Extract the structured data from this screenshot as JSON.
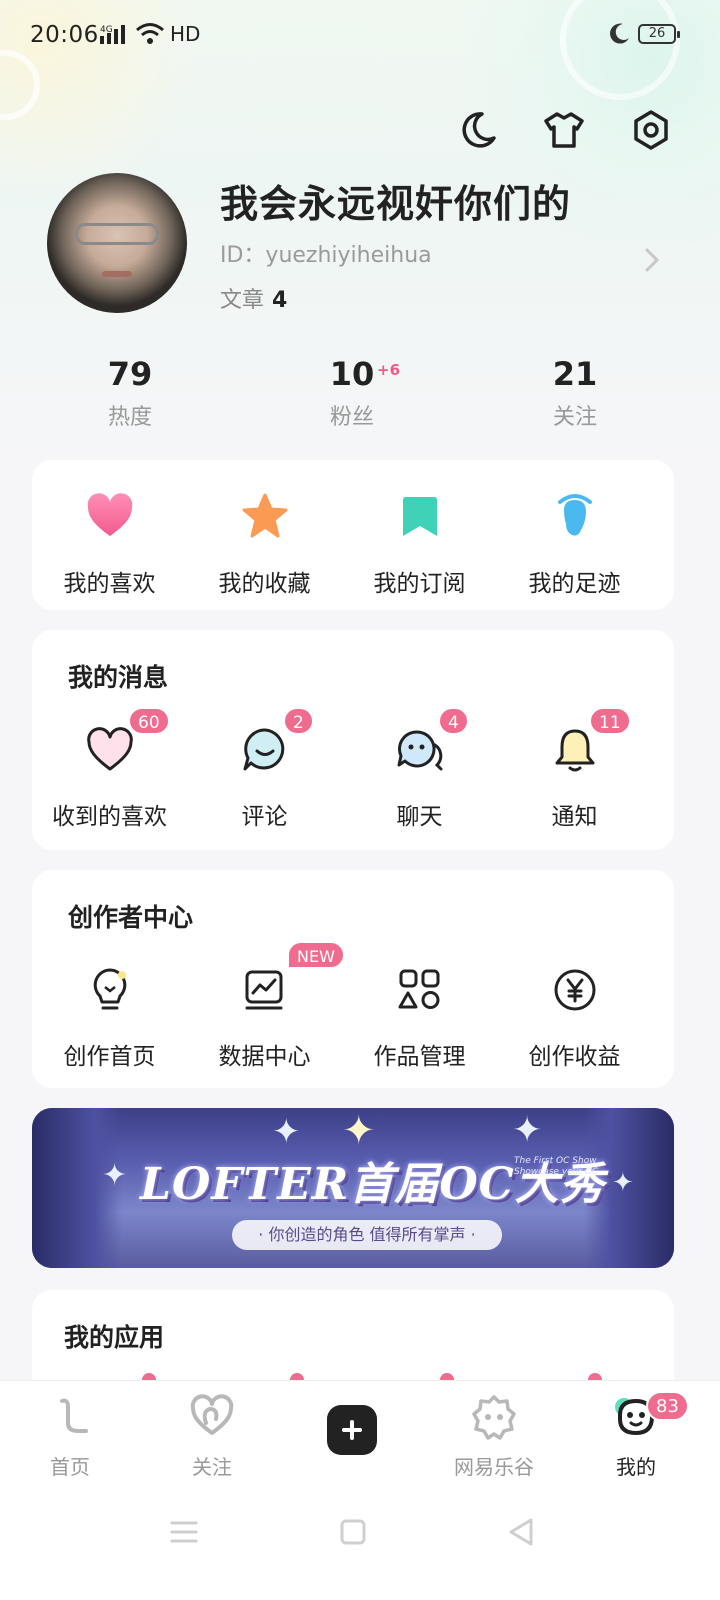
{
  "status_bar": {
    "time": "20:06",
    "signal": "4G",
    "network": "HD",
    "battery": "26"
  },
  "profile": {
    "username": "我会永远视奸你们的",
    "id_label": "ID：yuezhiyiheihua",
    "articles_label": "文章",
    "articles_count": "4"
  },
  "stats": [
    {
      "value": "79",
      "label": "热度"
    },
    {
      "value": "10",
      "label": "粉丝",
      "delta": "+6"
    },
    {
      "value": "21",
      "label": "关注"
    }
  ],
  "shortcuts": [
    {
      "label": "我的喜欢",
      "icon": "heart-icon"
    },
    {
      "label": "我的收藏",
      "icon": "star-icon"
    },
    {
      "label": "我的订阅",
      "icon": "bookmark-icon"
    },
    {
      "label": "我的足迹",
      "icon": "footprint-icon"
    }
  ],
  "messages": {
    "title": "我的消息",
    "items": [
      {
        "label": "收到的喜欢",
        "badge": "60",
        "icon": "heart-outline-icon"
      },
      {
        "label": "评论",
        "badge": "2",
        "icon": "comment-icon"
      },
      {
        "label": "聊天",
        "badge": "4",
        "icon": "chat-icon"
      },
      {
        "label": "通知",
        "badge": "11",
        "icon": "bell-icon"
      }
    ]
  },
  "creator": {
    "title": "创作者中心",
    "items": [
      {
        "label": "创作首页",
        "icon": "bulb-icon"
      },
      {
        "label": "数据中心",
        "icon": "chart-icon",
        "badge": "NEW"
      },
      {
        "label": "作品管理",
        "icon": "shapes-icon"
      },
      {
        "label": "创作收益",
        "icon": "yuan-icon"
      }
    ]
  },
  "banner": {
    "title": "LOFTER首届OC大秀",
    "subtitle": "· 你创造的角色 值得所有掌声 ·",
    "english": "The First OC Show Showcase your OC"
  },
  "apps": {
    "title": "我的应用"
  },
  "tabbar": [
    {
      "label": "首页",
      "icon": "home-icon"
    },
    {
      "label": "关注",
      "icon": "follow-icon"
    },
    {
      "label": "",
      "icon": "plus-icon"
    },
    {
      "label": "网易乐谷",
      "icon": "legu-icon"
    },
    {
      "label": "我的",
      "icon": "me-icon",
      "badge": "83"
    }
  ],
  "colors": {
    "accent": "#f06c8f",
    "text": "#222222",
    "muted": "#999999"
  }
}
